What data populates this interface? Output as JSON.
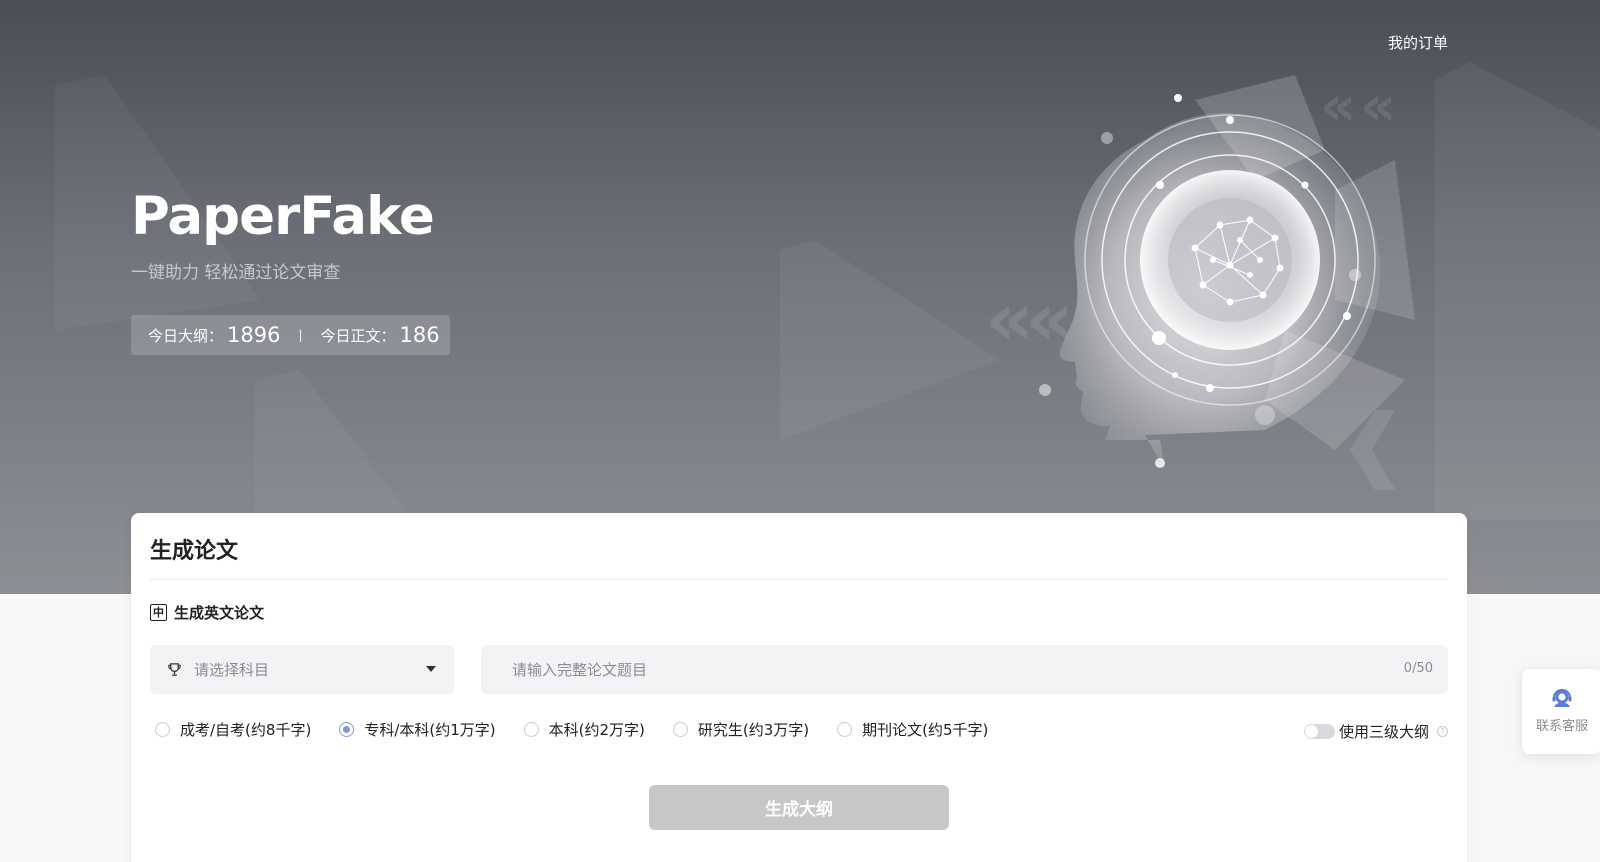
{
  "header": {
    "orders_link": "我的订单",
    "brand": "PaperFake",
    "tagline": "一键助力 轻松通过论文审查",
    "stats": {
      "outline_label": "今日大纲：",
      "outline_count": "1896",
      "separator": "|",
      "body_label": "今日正文：",
      "body_count": "186"
    }
  },
  "card": {
    "title": "生成论文",
    "english_toggle": {
      "icon_char": "中",
      "label": "生成英文论文"
    },
    "subject_select": {
      "placeholder": "请选择科目",
      "icon": "trophy-icon"
    },
    "title_input": {
      "placeholder": "请输入完整论文题目",
      "counter": "0/50"
    },
    "levels": [
      {
        "label": "成考/自考(约8千字)",
        "checked": false
      },
      {
        "label": "专科/本科(约1万字)",
        "checked": true
      },
      {
        "label": "本科(约2万字)",
        "checked": false
      },
      {
        "label": "研究生(约3万字)",
        "checked": false
      },
      {
        "label": "期刊论文(约5千字)",
        "checked": false
      }
    ],
    "three_level_outline": {
      "label": "使用三级大纲",
      "enabled": false,
      "help_char": "?"
    },
    "generate_button": "生成大纲"
  },
  "support": {
    "label": "联系客服",
    "icon": "customer-service-icon"
  },
  "colors": {
    "accent": "#7c9bdc",
    "button_disabled": "#c6c7c9"
  }
}
